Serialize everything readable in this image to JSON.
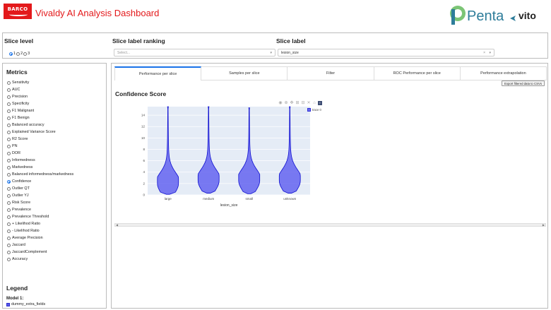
{
  "header": {
    "brand_logo_text": "BARCO",
    "app_title": "Vivaldy AI Analysis Dashboard",
    "partner_logo_text": "Penta",
    "partner_logo_text2": "vito"
  },
  "slice": {
    "level_label": "Slice level",
    "level_options": [
      "1",
      "2",
      "3"
    ],
    "level_selected": "1",
    "ranking_label": "Slice label ranking",
    "ranking_placeholder": "Select...",
    "label_label": "Slice label",
    "label_value": "lesion_size"
  },
  "metrics": {
    "title": "Metrics",
    "items": [
      "Sensitivity",
      "AUC",
      "Precision",
      "Specificity",
      "F1 Malignant",
      "F1 Benign",
      "Balanced accuracy",
      "Explained Variance Score",
      "R2 Score",
      "PN",
      "DOR",
      "Informedness",
      "Markedness",
      "Balanced informedness/markedness",
      "Confidence",
      "Outlier QT",
      "Outlier YJ",
      "Risk Score",
      "Prevalence",
      "Prevalence Threshold",
      "+ Likelihod Ratio",
      "- Likelihod Ratio",
      "Average Precision",
      "Jaccard",
      "JaccardComplement",
      "Accuracy"
    ],
    "selected": "Confidence"
  },
  "legend": {
    "title": "Legend",
    "model_label": "Model 1:",
    "model_name": "dummy_extra_fields"
  },
  "tabs": {
    "items": [
      "Performance per slice",
      "Samples per slice",
      "Filter",
      "ROC Performance per slice",
      "Performance extrapolation"
    ],
    "active": "Performance per slice"
  },
  "main": {
    "export_button": "Export filtered data to CSVs",
    "chart_heading": "Confidence Score"
  },
  "colors": {
    "brand_red": "#e3191b",
    "violin_fill": "#6464f0",
    "violin_line": "#1010d0",
    "plot_bg": "#e5ecf6",
    "accent_blue": "#1a73e8"
  },
  "chart_data": {
    "type": "violin",
    "categories": [
      "large",
      "medium",
      "small",
      "unknown"
    ],
    "xlabel": "lesion_size",
    "ylabel": "",
    "ylim": [
      0,
      15.5
    ],
    "yticks": [
      0,
      2,
      4,
      6,
      8,
      10,
      12,
      14
    ],
    "series": [
      {
        "name": "trace 0",
        "color": "#6464f0"
      }
    ],
    "distributions": [
      {
        "category": "large",
        "min": 0.1,
        "max": 15.5,
        "mode": 2.0
      },
      {
        "category": "medium",
        "min": 0.3,
        "max": 15.5,
        "mode": 2.5
      },
      {
        "category": "small",
        "min": 0.2,
        "max": 15.3,
        "mode": 2.5
      },
      {
        "category": "unknown",
        "min": 0.3,
        "max": 15.5,
        "mode": 2.5
      }
    ],
    "legend_position": "top-right",
    "grid": true
  }
}
